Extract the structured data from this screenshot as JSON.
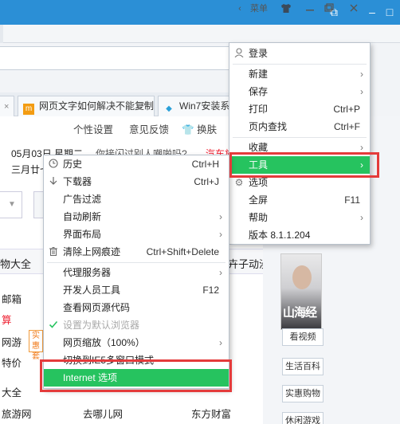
{
  "window_controls": {
    "restore": "⧉",
    "minimize": "–",
    "maximize": "□"
  },
  "toolbar": {
    "menu_label": "菜单",
    "back_arrow": "‹",
    "shirt": "👕"
  },
  "tabs": [
    {
      "label": "网页文字如何解决不能复制",
      "icon_text": "m"
    },
    {
      "label": "Win7安装系统",
      "icon_text": "◆"
    }
  ],
  "page": {
    "toplinks": [
      "个性设置",
      "意见反馈",
      "换肤"
    ],
    "date_line": "05月03日 星期二",
    "date_tail": "你接闪过别人嘲啪吗?",
    "lunar": "三月廿七",
    "ad_text": "汽车旅行，",
    "tab_left": "物大全",
    "tab_right": "卉子动漫",
    "list": [
      "邮箱",
      "算",
      "网游",
      "特价",
      "大全",
      "旅游网"
    ],
    "badge": [
      "实惠",
      "套"
    ],
    "bottom": [
      "去哪儿网",
      "东方财富"
    ]
  },
  "side": {
    "title_art": "山海经",
    "buttons": [
      "看视频",
      "生活百科",
      "实惠购物",
      "休闲游戏"
    ]
  },
  "main_menu": {
    "login": "登录",
    "items": [
      {
        "label": "新建",
        "arrow": "›"
      },
      {
        "label": "保存",
        "arrow": "›"
      },
      {
        "label": "打印",
        "shortcut": "Ctrl+P"
      },
      {
        "label": "页内查找",
        "shortcut": "Ctrl+F"
      },
      {
        "label": "收藏",
        "arrow": "›"
      },
      {
        "label": "工具",
        "arrow": "›"
      },
      {
        "label": "选项"
      },
      {
        "label": "全屏",
        "shortcut": "F11"
      },
      {
        "label": "帮助",
        "arrow": "›"
      },
      {
        "label": "版本 8.1.1.204"
      }
    ]
  },
  "tools_menu": {
    "items": [
      {
        "label": "历史",
        "shortcut": "Ctrl+H"
      },
      {
        "label": "下载器",
        "shortcut": "Ctrl+J"
      },
      {
        "label": "广告过滤"
      },
      {
        "label": "自动刷新",
        "arrow": "›"
      },
      {
        "label": "界面布局",
        "arrow": "›"
      },
      {
        "label": "清除上网痕迹",
        "shortcut": "Ctrl+Shift+Delete"
      },
      {
        "label": "代理服务器",
        "arrow": "›"
      },
      {
        "label": "开发人员工具",
        "shortcut": "F12"
      },
      {
        "label": "查看网页源代码"
      },
      {
        "label": "设置为默认浏览器"
      },
      {
        "label": "网页缩放（100%）",
        "arrow": "›"
      },
      {
        "label": "切换到IE5多窗口模式"
      },
      {
        "label": "Internet 选项"
      }
    ]
  },
  "colors": {
    "title_bar": "#2b8fd6",
    "active": "#26c35f",
    "highlight_box": "#e43b3b"
  }
}
